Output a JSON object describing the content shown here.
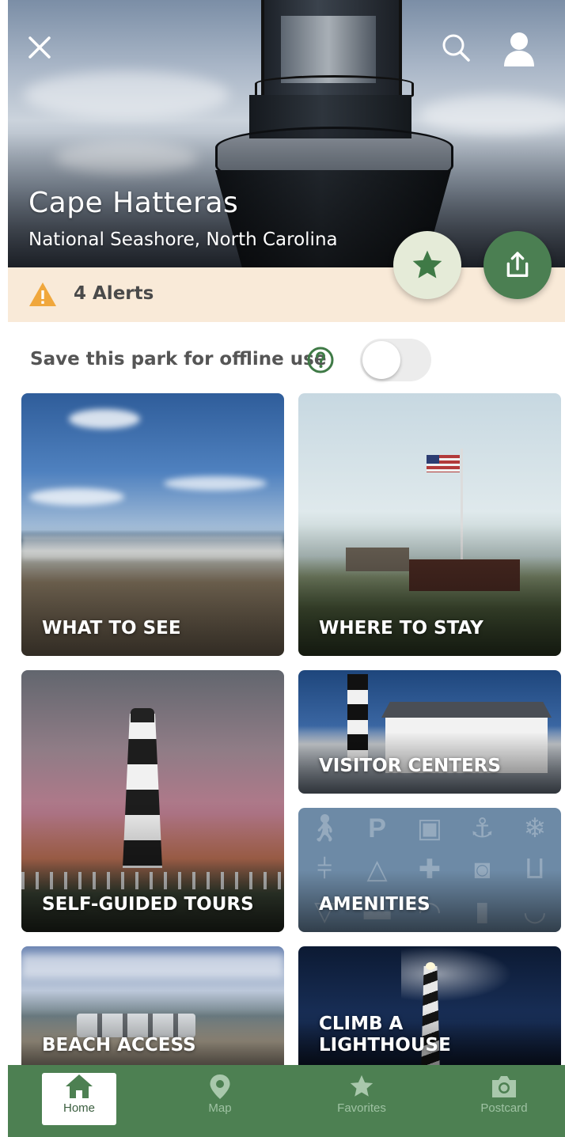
{
  "park": {
    "title": "Cape Hatteras",
    "subtitle": "National Seashore, North Carolina"
  },
  "alerts": {
    "label": "4 Alerts"
  },
  "offline": {
    "label": "Save this park for offline use",
    "enabled": false
  },
  "tiles": {
    "what_to_see": "WHAT TO SEE",
    "where_to_stay": "WHERE TO STAY",
    "self_guided_tours": "SELF-GUIDED TOURS",
    "visitor_centers": "VISITOR CENTERS",
    "amenities": "AMENITIES",
    "beach_access": "BEACH ACCESS",
    "climb_a_lighthouse_line1": "CLIMB A",
    "climb_a_lighthouse_line2": "LIGHTHOUSE"
  },
  "nav": {
    "home": "Home",
    "map": "Map",
    "favorites": "Favorites",
    "postcard": "Postcard",
    "active": "home"
  },
  "colors": {
    "brand_green": "#4d8052",
    "alert_bg": "#f9ead8",
    "alert_icon": "#f0a73c"
  }
}
